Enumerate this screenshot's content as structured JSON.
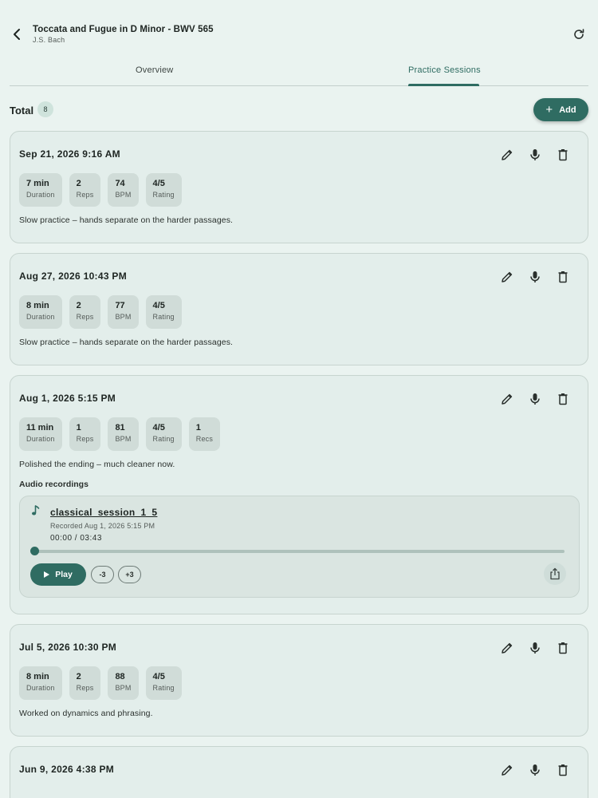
{
  "header": {
    "title": "Toccata and Fugue in D Minor - BWV 565",
    "subtitle": "J.S. Bach"
  },
  "tabs": [
    {
      "label": "Overview",
      "active": false
    },
    {
      "label": "Practice Sessions",
      "active": true
    }
  ],
  "summary": {
    "total_label": "Total",
    "total_count": "8",
    "add_label": "Add"
  },
  "colors": {
    "accent": "#2f6c62",
    "background": "#eaf3f0",
    "card": "#e3eeeb"
  },
  "sessions": [
    {
      "date": "Sep 21, 2026 9:16 AM",
      "stats": [
        {
          "value": "7 min",
          "label": "Duration"
        },
        {
          "value": "2",
          "label": "Reps"
        },
        {
          "value": "74",
          "label": "BPM"
        },
        {
          "value": "4/5",
          "label": "Rating"
        }
      ],
      "note": "Slow practice – hands separate on the harder passages."
    },
    {
      "date": "Aug 27, 2026 10:43 PM",
      "stats": [
        {
          "value": "8 min",
          "label": "Duration"
        },
        {
          "value": "2",
          "label": "Reps"
        },
        {
          "value": "77",
          "label": "BPM"
        },
        {
          "value": "4/5",
          "label": "Rating"
        }
      ],
      "note": "Slow practice – hands separate on the harder passages."
    },
    {
      "date": "Aug 1, 2026 5:15 PM",
      "stats": [
        {
          "value": "11 min",
          "label": "Duration"
        },
        {
          "value": "1",
          "label": "Reps"
        },
        {
          "value": "81",
          "label": "BPM"
        },
        {
          "value": "4/5",
          "label": "Rating"
        },
        {
          "value": "1",
          "label": "Recs"
        }
      ],
      "note": "Polished the ending – much cleaner now.",
      "recordings_heading": "Audio recordings",
      "recording": {
        "name": "classical_session_1_5",
        "recorded": "Recorded Aug 1, 2026 5:15 PM",
        "time": "00:00 / 03:43",
        "progress": 0,
        "play_label": "Play",
        "skip_back": "-3",
        "skip_forward": "+3"
      }
    },
    {
      "date": "Jul 5, 2026 10:30 PM",
      "stats": [
        {
          "value": "8 min",
          "label": "Duration"
        },
        {
          "value": "2",
          "label": "Reps"
        },
        {
          "value": "88",
          "label": "BPM"
        },
        {
          "value": "4/5",
          "label": "Rating"
        }
      ],
      "note": "Worked on dynamics and phrasing."
    },
    {
      "date": "Jun 9, 2026 4:38 PM"
    }
  ]
}
